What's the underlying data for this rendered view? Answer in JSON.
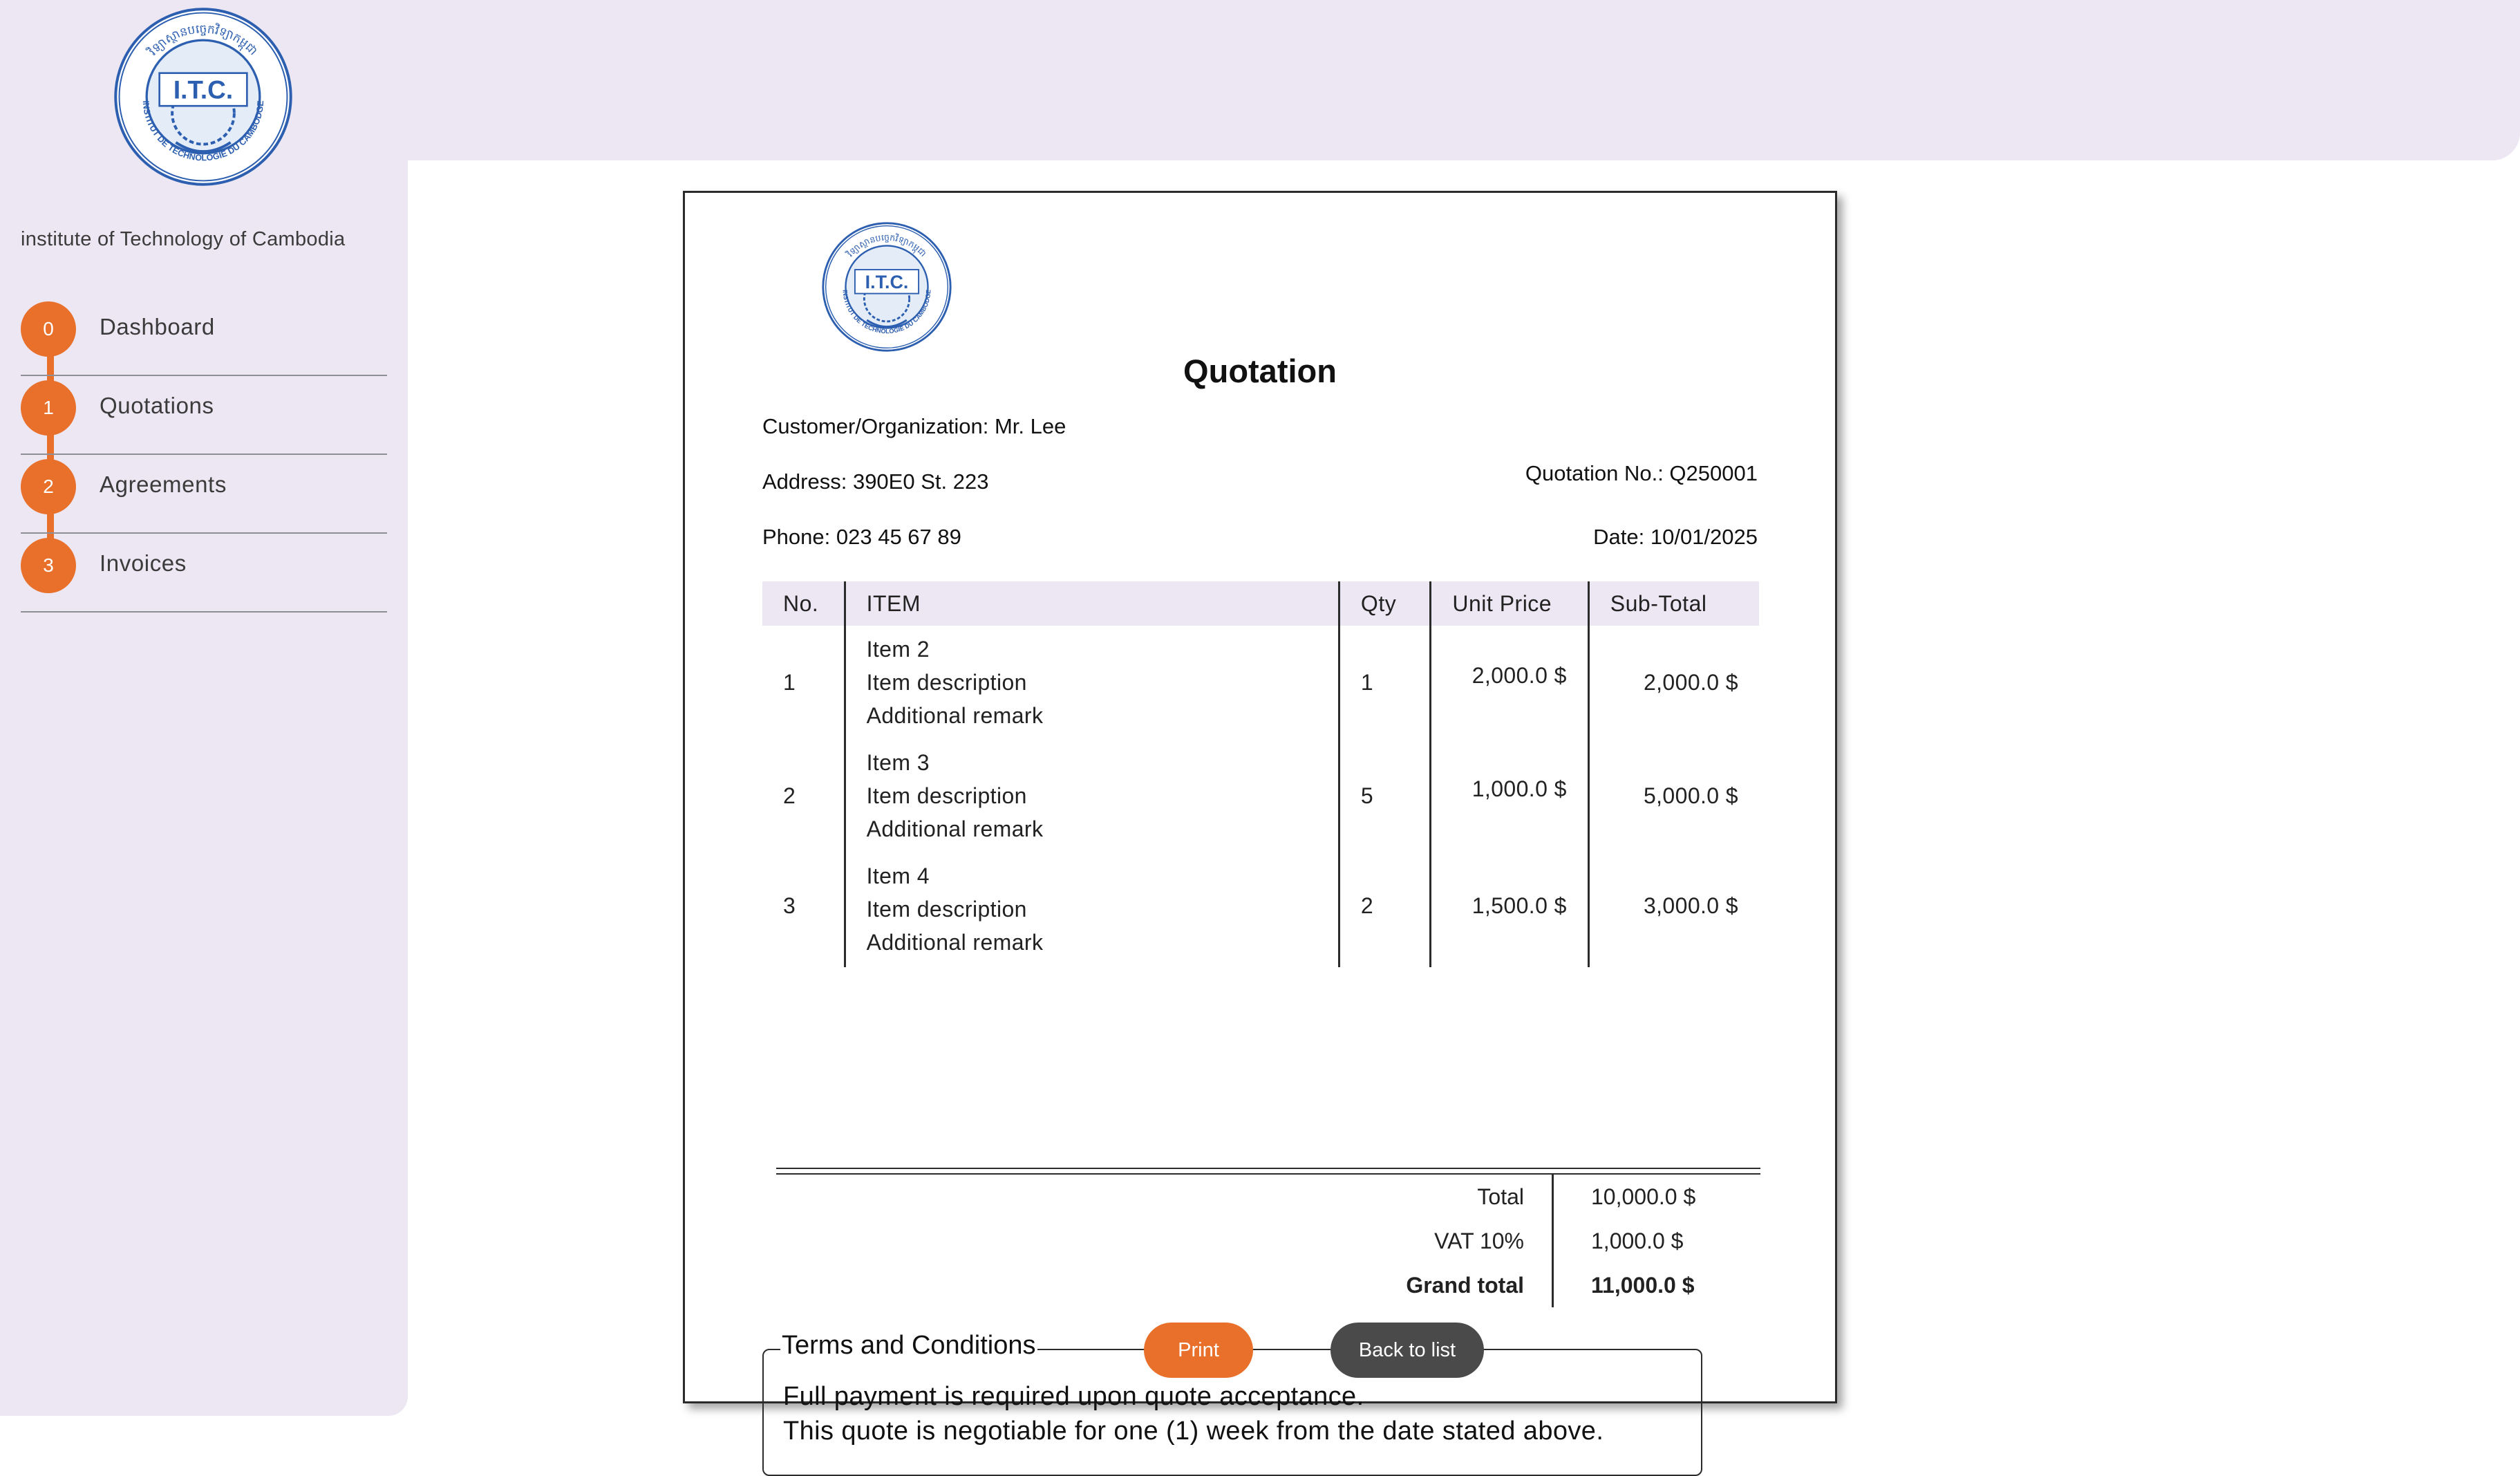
{
  "sidebar": {
    "org_name": "institute of Technology of Cambodia",
    "nav": [
      {
        "index": "0",
        "label": "Dashboard"
      },
      {
        "index": "1",
        "label": "Quotations"
      },
      {
        "index": "2",
        "label": "Agreements"
      },
      {
        "index": "3",
        "label": "Invoices"
      }
    ]
  },
  "logo": {
    "top_arc": "វិទ្យាស្ថានបច្ចេកវិទ្យាកម្ពុជា",
    "initials": "I.T.C.",
    "bottom_arc": "INSTITUT DE TECHNOLOGIE DU CAMBODGE"
  },
  "document": {
    "title": "Quotation",
    "customer": "Customer/Organization: Mr. Lee",
    "address": "Address: 390E0 St. 223",
    "phone": "Phone: 023 45 67 89",
    "quotation_no": "Quotation No.: Q250001",
    "date": "Date: 10/01/2025"
  },
  "table": {
    "headers": {
      "no": "No.",
      "item": "ITEM",
      "qty": "Qty",
      "unit_price": "Unit Price",
      "sub_total": "Sub-Total"
    },
    "rows": [
      {
        "no": "1",
        "name": "Item 2",
        "description": "Item description",
        "remark": "Additional remark",
        "qty": "1",
        "unit_price": "2,000.0 $",
        "sub_total": "2,000.0 $"
      },
      {
        "no": "2",
        "name": "Item 3",
        "description": "Item description",
        "remark": "Additional remark",
        "qty": "5",
        "unit_price": "1,000.0 $",
        "sub_total": "5,000.0 $"
      },
      {
        "no": "3",
        "name": "Item 4",
        "description": "Item description",
        "remark": "Additional remark",
        "qty": "2",
        "unit_price": "1,500.0 $",
        "sub_total": "3,000.0 $"
      }
    ]
  },
  "totals": {
    "total_label": "Total",
    "total_value": "10,000.0 $",
    "vat_label": "VAT 10%",
    "vat_value": "1,000.0 $",
    "grand_label": "Grand total",
    "grand_value": "11,000.0 $"
  },
  "terms": {
    "title": "Terms and Conditions",
    "line1": "Full payment is required upon quote acceptance.",
    "line2": "This quote is negotiable for one (1) week from the date stated above."
  },
  "buttons": {
    "print": "Print",
    "back": "Back to list"
  },
  "colors": {
    "accent": "#e8702a",
    "sidebar_bg": "#ece7f3",
    "logo_blue": "#2d5fb0",
    "dark_button": "#4a4a4a"
  }
}
